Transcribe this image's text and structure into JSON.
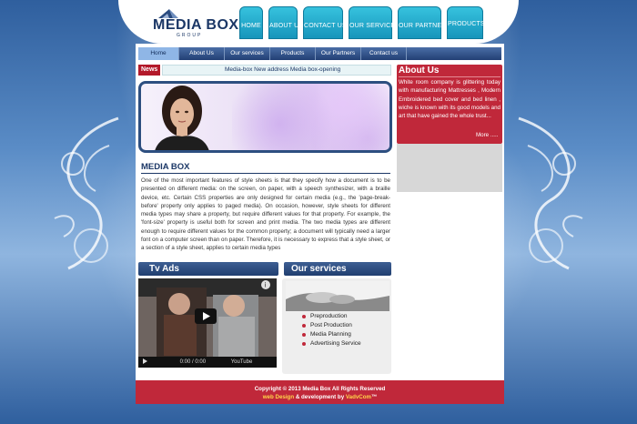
{
  "brand": {
    "name": "MEDIA BOX",
    "tagline": "GROUP"
  },
  "top_tabs": [
    "HOME",
    "ABOUT US",
    "CONTACT US",
    "OUR SERVICES",
    "OUR PARTNERS",
    "PRODUCTS"
  ],
  "subnav": [
    "Home",
    "About Us",
    "Our services",
    "Products",
    "Our Partners",
    "Contact us"
  ],
  "news": {
    "label": "News",
    "ticker": "Media-box New address   Media box-opening"
  },
  "article": {
    "title": "MEDIA BOX",
    "body": "One of the most important features of style sheets is that they specify how a document is to be presented on different media: on the screen, on paper, with a speech synthesizer, with a braille device, etc. Certain CSS properties are only designed for certain media (e.g., the 'page-break-before' property only applies to paged media). On occasion, however, style sheets for different media types may share a property, but require different values for that property. For example, the 'font-size' property is useful both for screen and print media. The two media types are different enough to require different values for the common property; a document will typically need a larger font on a computer screen than on paper. Therefore, it is necessary to express that a style sheet, or a section of a style sheet, applies to certain media types"
  },
  "about": {
    "title": "About Us",
    "text": "White room company is glittering today with manufacturing Mattresses , Modern Embroidered bed cover and bed linen , wiche is known with its good models and art that have gained the whole trust...",
    "more": "More ....."
  },
  "tv_ads": {
    "title": "Tv Ads",
    "time": "0:00 / 0:00",
    "brand": "YouTube"
  },
  "services": {
    "title": "Our services",
    "items": [
      "Preproduction",
      "Post Production",
      "Media Planning",
      "Advertising Service"
    ]
  },
  "footer": {
    "copyright": "Copyright © 2013 Media Box All Rights Reserved",
    "web_design": "web Design",
    "development": " & development by ",
    "company": "VadvCom",
    "tm": "™"
  },
  "colors": {
    "accent_red": "#c0283a",
    "navy": "#1b3766",
    "cyan_tab": "#1795bb"
  }
}
